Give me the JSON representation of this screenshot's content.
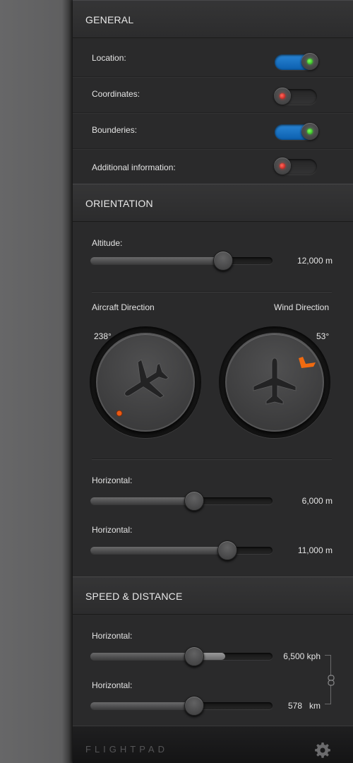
{
  "general": {
    "title": "GENERAL",
    "toggles": [
      {
        "label": "Location:",
        "on": true
      },
      {
        "label": "Coordinates:",
        "on": false
      },
      {
        "label": "Bounderies:",
        "on": true
      },
      {
        "label": "Additional information:",
        "on": false
      }
    ]
  },
  "orientation": {
    "title": "ORIENTATION",
    "altitude": {
      "label": "Altitude:",
      "value": "12,000 m",
      "fraction": 0.73
    },
    "aircraft_direction": {
      "label": "Aircraft Direction",
      "degrees": "238°"
    },
    "wind_direction": {
      "label": "Wind Direction",
      "degrees": "53°"
    },
    "horizontal_1": {
      "label": "Horizontal:",
      "value": "6,000 m",
      "fraction": 0.57
    },
    "horizontal_2": {
      "label": "Horizontal:",
      "value": "11,000 m",
      "fraction": 0.75
    }
  },
  "speed_distance": {
    "title": "SPEED & DISTANCE",
    "horizontal_1": {
      "label": "Horizontal:",
      "value": "6,500 kph",
      "fraction": 0.57,
      "buffer_fraction": 0.74
    },
    "horizontal_2": {
      "label": "Horizontal:",
      "value": "578   km",
      "fraction": 0.57
    }
  },
  "footer": {
    "brand": "FLIGHTPAD",
    "settings_icon": "gear-icon"
  },
  "colors": {
    "toggle_on": "#1a73c4",
    "indicator_on": "#2ecc1a",
    "indicator_off": "#e0201a",
    "wind_marker": "#f06a10"
  }
}
